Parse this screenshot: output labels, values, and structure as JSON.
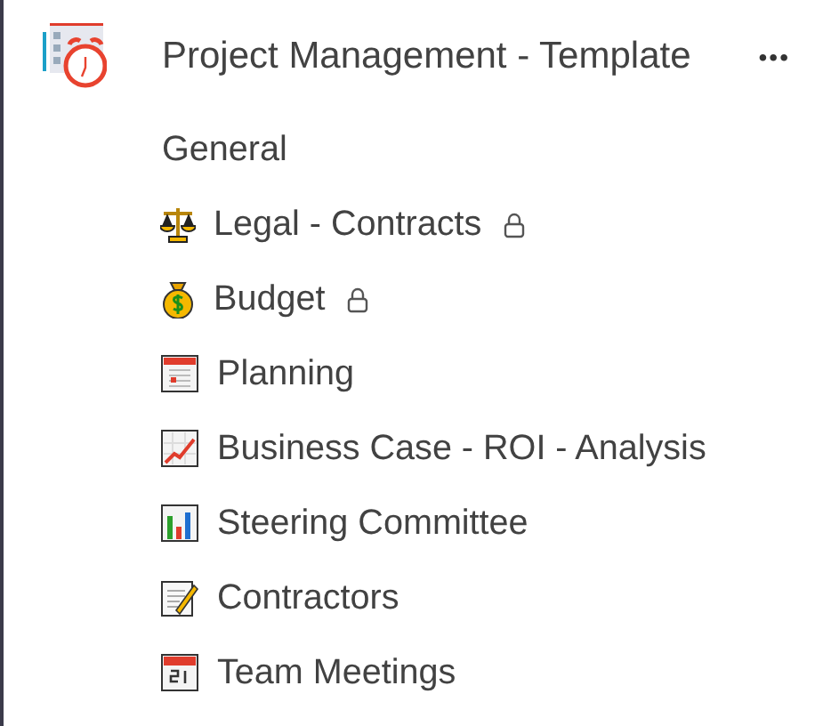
{
  "team": {
    "name": "Project Management - Template",
    "more": "•••"
  },
  "channels": [
    {
      "name": "General",
      "locked": false
    },
    {
      "name": "Legal - Contracts",
      "locked": true
    },
    {
      "name": "Budget",
      "locked": true
    },
    {
      "name": "Planning",
      "locked": false
    },
    {
      "name": "Business Case - ROI - Analysis",
      "locked": false
    },
    {
      "name": "Steering Committee",
      "locked": false
    },
    {
      "name": "Contractors",
      "locked": false
    },
    {
      "name": "Team Meetings",
      "locked": false
    }
  ]
}
